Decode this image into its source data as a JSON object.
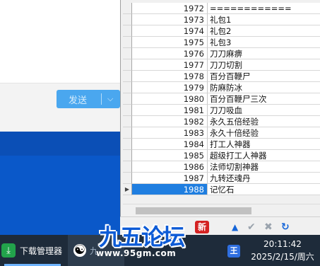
{
  "chat": {
    "send_label": "发送",
    "send_dropdown_icon": "chevron-down-icon"
  },
  "grid": {
    "rows": [
      {
        "num": "1972",
        "text": "============"
      },
      {
        "num": "1973",
        "text": "礼包1"
      },
      {
        "num": "1974",
        "text": "礼包2"
      },
      {
        "num": "1975",
        "text": "礼包3"
      },
      {
        "num": "1976",
        "text": "刀刀麻痹"
      },
      {
        "num": "1977",
        "text": "刀刀切割"
      },
      {
        "num": "1978",
        "text": "百分百鞭尸"
      },
      {
        "num": "1979",
        "text": "防麻防冰"
      },
      {
        "num": "1980",
        "text": "百分百鞭尸三次"
      },
      {
        "num": "1981",
        "text": "刀刀吸血"
      },
      {
        "num": "1982",
        "text": "永久五倍经验"
      },
      {
        "num": "1983",
        "text": "永久十倍经验"
      },
      {
        "num": "1984",
        "text": "打工人神器"
      },
      {
        "num": "1985",
        "text": "超级打工人神器"
      },
      {
        "num": "1986",
        "text": "法师切割神器"
      },
      {
        "num": "1987",
        "text": "九转还魂丹"
      },
      {
        "num": "1988",
        "text": "记忆石"
      }
    ],
    "selected_index": 16,
    "selected_indicator": "▶"
  },
  "navigator": {
    "buttons": [
      "add-icon",
      "first-icon",
      "up-icon",
      "confirm-icon",
      "cancel-icon",
      "refresh-icon"
    ]
  },
  "taskbar": {
    "items": [
      {
        "label": "下载管理器",
        "icon": "download-manager-icon"
      },
      {
        "label": "九",
        "icon": "yinyang-icon"
      }
    ],
    "time": "20:11:42",
    "date": "2025/2/15/周六"
  },
  "watermark": {
    "title": "九五论坛",
    "url": "www.95gm.com",
    "seal": "新"
  },
  "colors": {
    "accent": "#1f7ee0",
    "send_button": "#4aa7ef",
    "desktop": "#0a58c9",
    "taskbar": "#1e2b3a",
    "watermark": "#0d5bd6"
  }
}
